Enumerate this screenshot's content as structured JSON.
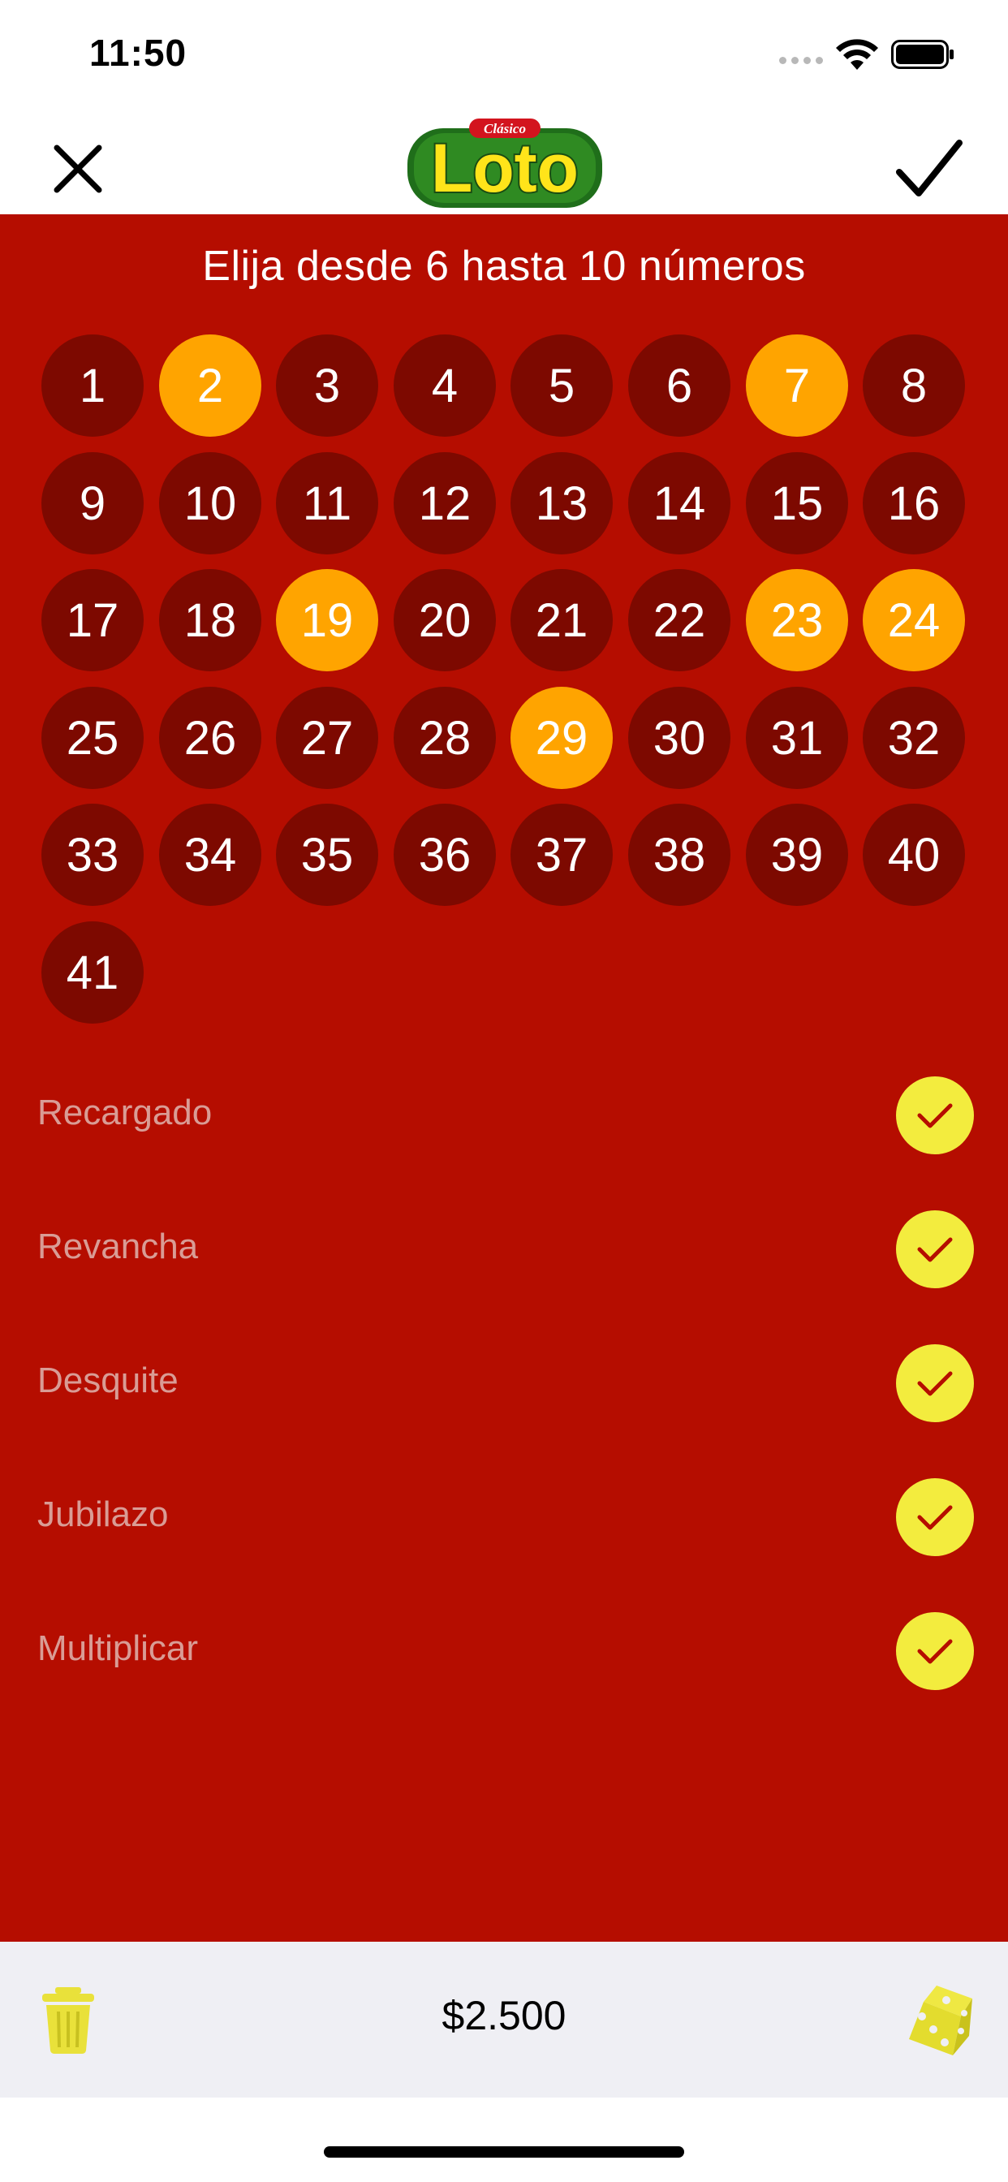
{
  "status_bar": {
    "time": "11:50"
  },
  "nav": {
    "logo_small_text": "Clásico",
    "logo_text": "Loto",
    "close_icon": "close-icon",
    "confirm_icon": "checkmark-icon"
  },
  "instruction": "Elija desde 6 hasta 10 números",
  "numbers": [
    "1",
    "2",
    "3",
    "4",
    "5",
    "6",
    "7",
    "8",
    "9",
    "10",
    "11",
    "12",
    "13",
    "14",
    "15",
    "16",
    "17",
    "18",
    "19",
    "20",
    "21",
    "22",
    "23",
    "24",
    "25",
    "26",
    "27",
    "28",
    "29",
    "30",
    "31",
    "32",
    "33",
    "34",
    "35",
    "36",
    "37",
    "38",
    "39",
    "40",
    "41"
  ],
  "selected_numbers": [
    "2",
    "7",
    "19",
    "23",
    "24",
    "29"
  ],
  "options": [
    {
      "label": "Recargado",
      "checked": true
    },
    {
      "label": "Revancha",
      "checked": true
    },
    {
      "label": "Desquite",
      "checked": true
    },
    {
      "label": "Jubilazo",
      "checked": true
    },
    {
      "label": "Multiplicar",
      "checked": true
    }
  ],
  "toolbar": {
    "price": "$2.500",
    "trash_icon": "trash-icon",
    "dice_icon": "dice-icon"
  },
  "colors": {
    "background_red": "#b50d00",
    "ball_unselected": "#7d0900",
    "ball_selected": "#ffa400",
    "check_yellow": "#f3ec3e",
    "option_label": "#d99c95",
    "toolbar_bg": "#efeff4"
  }
}
